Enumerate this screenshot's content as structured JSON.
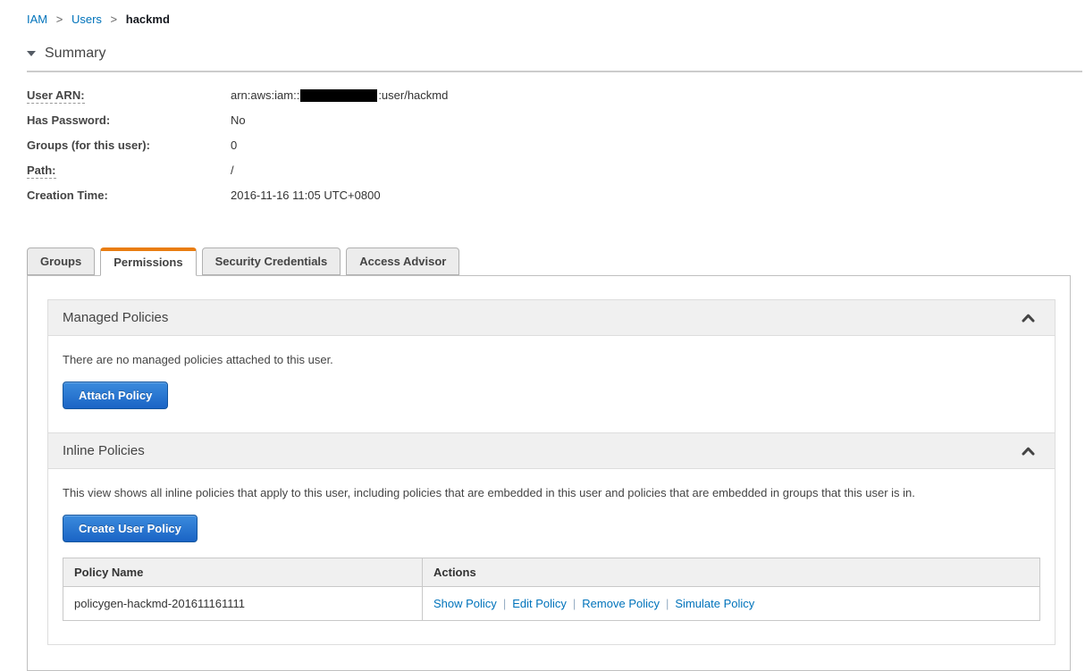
{
  "breadcrumb": {
    "separator": ">",
    "items": [
      {
        "label": "IAM"
      },
      {
        "label": "Users"
      },
      {
        "label": "hackmd"
      }
    ]
  },
  "summary": {
    "title": "Summary",
    "fields": {
      "user_arn": {
        "label": "User ARN:",
        "value_prefix": "arn:aws:iam::",
        "value_suffix": ":user/hackmd",
        "redacted_account_id": true
      },
      "has_password": {
        "label": "Has Password:",
        "value": "No"
      },
      "groups": {
        "label": "Groups (for this user):",
        "value": "0"
      },
      "path": {
        "label": "Path:",
        "value": "/"
      },
      "creation_time": {
        "label": "Creation Time:",
        "value": "2016-11-16 11:05 UTC+0800"
      }
    }
  },
  "tabs": [
    {
      "label": "Groups",
      "active": false
    },
    {
      "label": "Permissions",
      "active": true
    },
    {
      "label": "Security Credentials",
      "active": false
    },
    {
      "label": "Access Advisor",
      "active": false
    }
  ],
  "managed_policies": {
    "title": "Managed Policies",
    "empty_text": "There are no managed policies attached to this user.",
    "attach_button_label": "Attach Policy",
    "collapse_icon": "chevron-up"
  },
  "inline_policies": {
    "title": "Inline Policies",
    "description": "This view shows all inline policies that apply to this user, including policies that are embedded in this user and policies that are embedded in groups that this user is in.",
    "create_button_label": "Create User Policy",
    "collapse_icon": "chevron-up",
    "table": {
      "headers": [
        "Policy Name",
        "Actions"
      ],
      "actions_separator": "|",
      "rows": [
        {
          "policy_name": "policygen-hackmd-201611161111",
          "actions": [
            "Show Policy",
            "Edit Policy",
            "Remove Policy",
            "Simulate Policy"
          ]
        }
      ]
    }
  },
  "colors": {
    "link_blue": "#0073bb",
    "tab_accent_orange": "#e97d11",
    "button_blue_top": "#3b8bdd",
    "button_blue_bottom": "#1a64c5",
    "panel_header_gray": "#f0f0f0"
  }
}
